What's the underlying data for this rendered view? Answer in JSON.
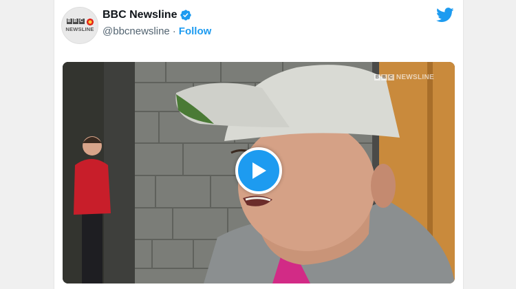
{
  "tweet": {
    "author": {
      "display_name": "BBC Newsline",
      "handle": "@bbcnewsline",
      "separator": "·",
      "follow_label": "Follow",
      "verified": true,
      "avatar_logo": {
        "blocks": [
          "B",
          "B",
          "C"
        ],
        "word": "NEWSLINE"
      }
    },
    "brand_icon": "twitter-bird-icon",
    "media": {
      "type": "video",
      "watermark": {
        "blocks": [
          "B",
          "B",
          "C"
        ],
        "word": "NEWSLINE"
      },
      "play_icon": "play-icon"
    }
  },
  "colors": {
    "accent": "#1d9bf0",
    "text_primary": "#0f1419",
    "text_secondary": "#536471",
    "page_bg": "#f0f0f0",
    "card_bg": "#ffffff"
  }
}
